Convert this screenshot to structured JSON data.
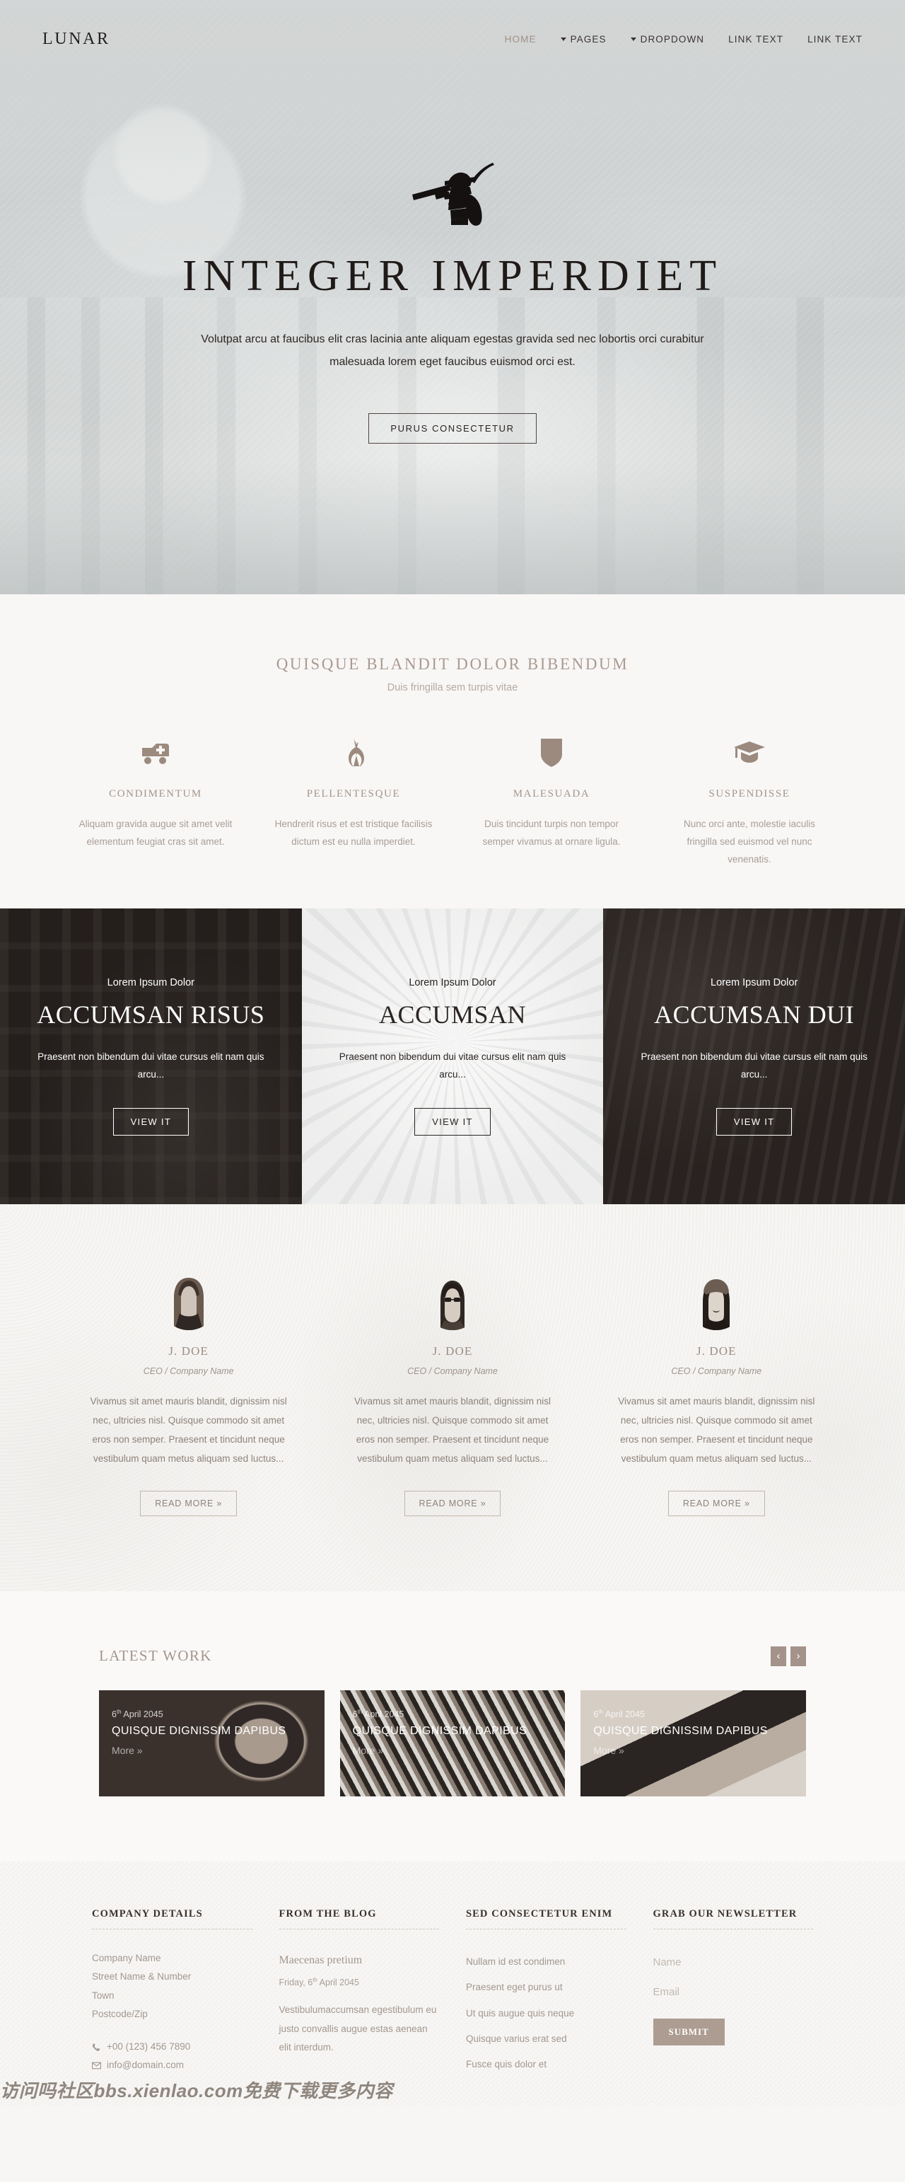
{
  "brand": {
    "logo": "LUNAR",
    "accent": "#a4938a",
    "dark": "#241f1d",
    "muted": "#a3978f"
  },
  "nav": [
    {
      "label": "HOME",
      "caret": false,
      "active": true
    },
    {
      "label": "PAGES",
      "caret": true,
      "active": false
    },
    {
      "label": "DROPDOWN",
      "caret": true,
      "active": false
    },
    {
      "label": "LINK TEXT",
      "caret": false,
      "active": false
    },
    {
      "label": "LINK TEXT",
      "caret": false,
      "active": false
    }
  ],
  "hero": {
    "mark_icon": "samurai-warrior-icon",
    "title": "INTEGER IMPERDIET",
    "subtitle": "Volutpat arcu at faucibus elit cras lacinia ante aliquam egestas gravida sed nec lobortis orci curabitur malesuada lorem eget faucibus euismod orci est.",
    "cta": "PURUS CONSECTETUR"
  },
  "features": {
    "title": "QUISQUE BLANDIT DOLOR BIBENDUM",
    "subtitle": "Duis fringilla sem turpis vitae",
    "items": [
      {
        "icon": "ambulance-icon",
        "name": "CONDIMENTUM",
        "text": "Aliquam gravida augue sit amet velit elementum feugiat cras sit amet."
      },
      {
        "icon": "rebel-alliance-icon",
        "name": "PELLENTESQUE",
        "text": "Hendrerit risus et est tristique facilisis dictum est eu nulla imperdiet."
      },
      {
        "icon": "shield-icon",
        "name": "MALESUADA",
        "text": "Duis tincidunt turpis non tempor semper vivamus at ornare ligula."
      },
      {
        "icon": "graduation-cap-icon",
        "name": "SUSPENDISSE",
        "text": "Nunc orci ante, molestie iaculis fringilla sed euismod vel nunc venenatis."
      }
    ]
  },
  "panels": [
    {
      "kicker": "Lorem Ipsum Dolor",
      "title": "ACCUMSAN RISUS",
      "text": "Praesent non bibendum dui vitae cursus elit nam quis arcu...",
      "cta": "VIEW IT",
      "theme": "dark"
    },
    {
      "kicker": "Lorem Ipsum Dolor",
      "title": "ACCUMSAN",
      "text": "Praesent non bibendum dui vitae cursus elit nam quis arcu...",
      "cta": "VIEW IT",
      "theme": "light"
    },
    {
      "kicker": "Lorem Ipsum Dolor",
      "title": "ACCUMSAN DUI",
      "text": "Praesent non bibendum dui vitae cursus elit nam quis arcu...",
      "cta": "VIEW IT",
      "theme": "dark3"
    }
  ],
  "testimonials": [
    {
      "avatar": "woman-long-hair-avatar",
      "name": "J. DOE",
      "role": "CEO / Company Name",
      "text": "Vivamus sit amet mauris blandit, dignissim nisl nec, ultricies nisl. Quisque commodo sit amet eros non semper. Praesent et tincidunt neque vestibulum quam metus aliquam sed luctus...",
      "cta": "READ MORE »"
    },
    {
      "avatar": "man-glasses-avatar",
      "name": "J. DOE",
      "role": "CEO / Company Name",
      "text": "Vivamus sit amet mauris blandit, dignissim nisl nec, ultricies nisl. Quisque commodo sit amet eros non semper. Praesent et tincidunt neque vestibulum quam metus aliquam sed luctus...",
      "cta": "READ MORE »"
    },
    {
      "avatar": "woman-hat-avatar",
      "name": "J. DOE",
      "role": "CEO / Company Name",
      "text": "Vivamus sit amet mauris blandit, dignissim nisl nec, ultricies nisl. Quisque commodo sit amet eros non semper. Praesent et tincidunt neque vestibulum quam metus aliquam sed luctus...",
      "cta": "READ MORE »"
    }
  ],
  "work": {
    "title": "LATEST WORK",
    "prev": "‹",
    "next": "›",
    "items": [
      {
        "day": "6",
        "ord": "th",
        "rest": " April 2045",
        "name": "QUISQUE DIGNISSIM DAPIBUS",
        "more": "More »"
      },
      {
        "day": "6",
        "ord": "th",
        "rest": " April 2045",
        "name": "QUISQUE DIGNISSIM DAPIBUS",
        "more": "More »"
      },
      {
        "day": "6",
        "ord": "th",
        "rest": " April 2045",
        "name": "QUISQUE DIGNISSIM DAPIBUS",
        "more": "More »"
      }
    ]
  },
  "footer": {
    "company": {
      "title": "COMPANY DETAILS",
      "lines": [
        "Company Name",
        "Street Name & Number",
        "Town",
        "Postcode/Zip"
      ],
      "phone": "+00 (123) 456 7890",
      "email": "info@domain.com"
    },
    "blog": {
      "title": "FROM THE BLOG",
      "post_title": "Maecenas pretium",
      "post_date_prefix": "Friday, 6",
      "post_date_ord": "th",
      "post_date_rest": " April 2045",
      "post_body": "Vestibulumaccumsan egestibulum eu justo convallis augue estas aenean elit interdum."
    },
    "links": {
      "title": "SED CONSECTETUR ENIM",
      "items": [
        "Nullam id est condimen",
        "Praesent eget purus ut",
        "Ut quis augue quis neque",
        "Quisque varius erat sed",
        "Fusce quis dolor et"
      ]
    },
    "newsletter": {
      "title": "GRAB OUR NEWSLETTER",
      "name_placeholder": "Name",
      "name_value": "",
      "email_placeholder": "Email",
      "email_value": "",
      "submit": "SUBMIT"
    }
  },
  "watermark": "访问吗社区bbs.xienlao.com免费下载更多内容"
}
